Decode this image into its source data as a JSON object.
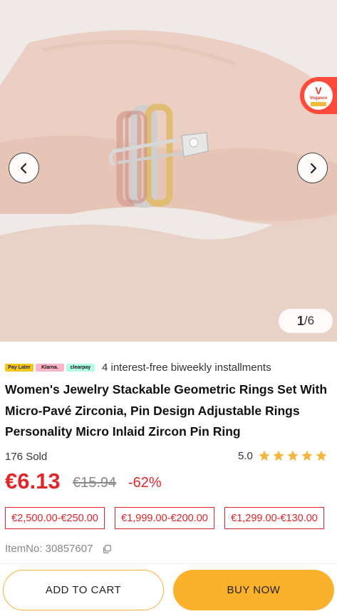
{
  "gallery": {
    "counter_current": "1",
    "counter_total": "/6",
    "prev_icon": "chevron-left-icon",
    "next_icon": "chevron-right-icon",
    "store_badge": {
      "letter": "V",
      "name": "Vogance"
    }
  },
  "payment": {
    "logos": [
      "Pay Later",
      "Klarna.",
      "clearpay"
    ],
    "text": "4 interest-free biweekly installments"
  },
  "product": {
    "title": "Women's Jewelry Stackable Geometric Rings Set With Micro-Pavé Zirconia, Pin Design Adjustable Rings Personality Micro Inlaid Zircon Pin Ring",
    "sold": "176 Sold",
    "rating": "5.0",
    "stars": 5,
    "price": "€6.13",
    "original_price": "€15.94",
    "discount": "-62%",
    "tiers": [
      "€2,500.00-€250.00",
      "€1,999.00-€200.00",
      "€1,299.00-€130.00"
    ],
    "item_no": "ItemNo: 30857607"
  },
  "actions": {
    "add_to_cart": "ADD TO CART",
    "buy_now": "BUY NOW"
  },
  "colors": {
    "price_red": "#e0262a",
    "star_gold": "#f6b53b",
    "buy_button": "#fbb12b"
  }
}
